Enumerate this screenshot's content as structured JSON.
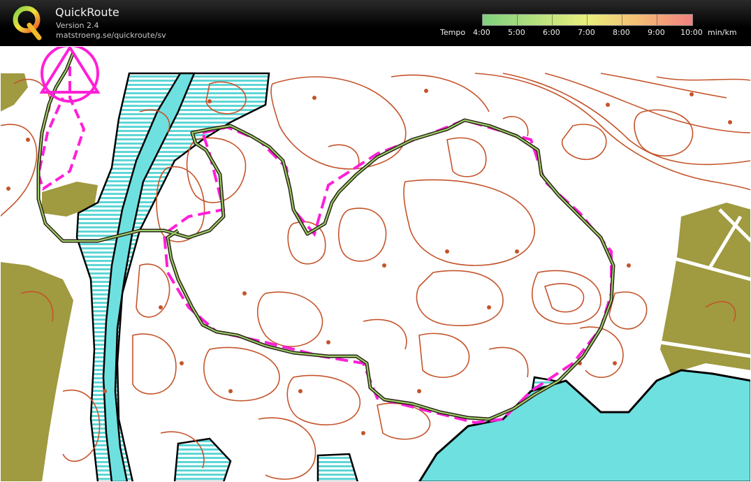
{
  "app": {
    "title": "QuickRoute",
    "version": "Version 2.4",
    "url": "matstroeng.se/quickroute/sv"
  },
  "legend": {
    "label": "Tempo",
    "values": [
      "4:00",
      "5:00",
      "6:00",
      "7:00",
      "8:00",
      "9:00",
      "10:00"
    ],
    "unit": "min/km"
  },
  "colors": {
    "header_bg": "#000000",
    "water": "#6fe0e0",
    "open_land": "#a09a40",
    "contour": "#c4542b",
    "course": "#ff1fd8",
    "route": "#4a3a20",
    "tempo_fast": "#7fd07f",
    "tempo_slow": "#f08080"
  },
  "icons": [
    "quickroute-logo-icon",
    "start-triangle-icon"
  ]
}
